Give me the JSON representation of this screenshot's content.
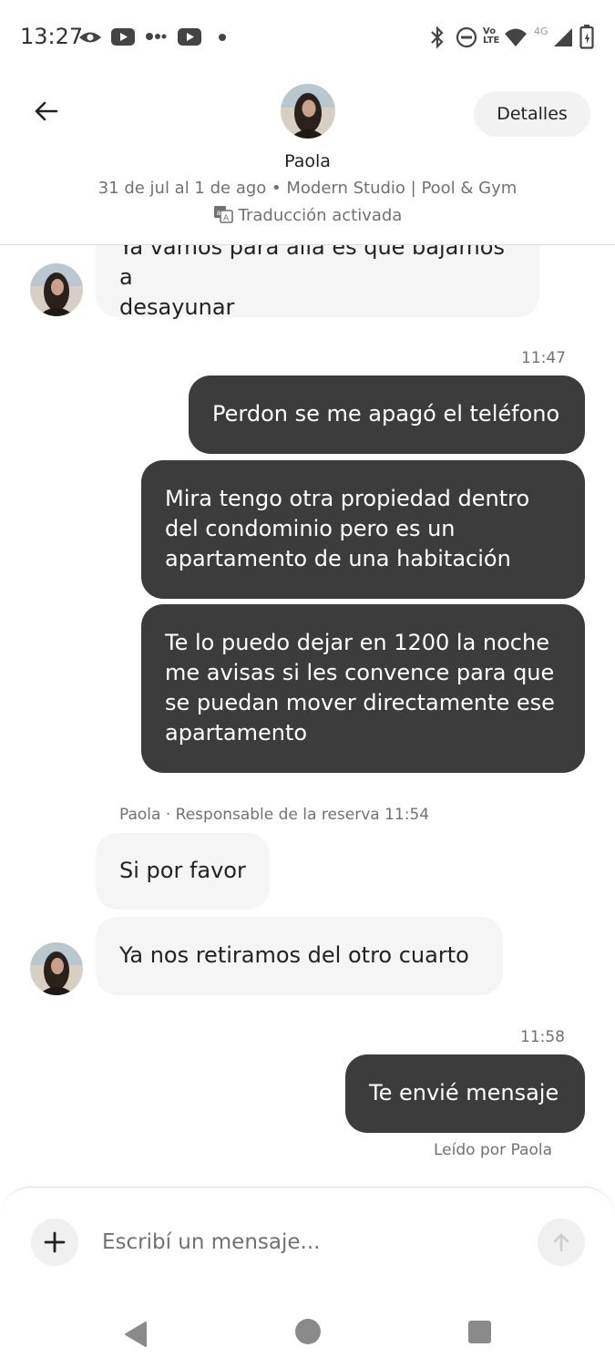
{
  "status_bar": {
    "time": "13:27",
    "left_icons": [
      "eye-icon",
      "youtube-icon",
      "more-dots-icon",
      "youtube-icon",
      "dot-icon"
    ],
    "right_icons": [
      "bluetooth-icon",
      "do-not-disturb-icon",
      "volte-icon",
      "wifi-icon",
      "signal-4g-icon",
      "battery-icon"
    ],
    "volte_text": "Vo LTE",
    "network_text": "4G"
  },
  "header": {
    "host_name": "Paola",
    "trip_info": "31 de jul al 1 de ago • Modern Studio | Pool & Gym",
    "translation_status": "Traducción activada",
    "details_label": "Detalles"
  },
  "messages": [
    {
      "from": "guest",
      "text_lines": [
        "Ya vamos para allá es que bajamos a",
        "desayunar"
      ]
    },
    {
      "from": "host",
      "time": "11:47",
      "text": "Perdon se me apagó el teléfono"
    },
    {
      "from": "host",
      "text_lines": [
        "Mira tengo otra propiedad dentro",
        "del condominio pero es un",
        "apartamento de una habitación"
      ]
    },
    {
      "from": "host",
      "text_lines": [
        "Te lo puedo dejar en 1200 la noche",
        "me avisas si les convence para que",
        "se puedan mover directamente ese",
        "apartamento"
      ]
    },
    {
      "from": "guest",
      "sender_label": "Paola · Responsable de la reserva",
      "time": "11:54",
      "text": "Si por favor"
    },
    {
      "from": "guest",
      "text": "Ya nos retiramos del otro cuarto"
    },
    {
      "from": "host",
      "time": "11:58",
      "text": "Te envié mensaje",
      "read_receipt": "Leído por Paola"
    }
  ],
  "composer": {
    "placeholder": "Escribí un mensaje..."
  },
  "colors": {
    "outgoing_bubble": "#3c3c3c",
    "incoming_bubble": "#f5f5f5",
    "muted_text": "#717171"
  }
}
